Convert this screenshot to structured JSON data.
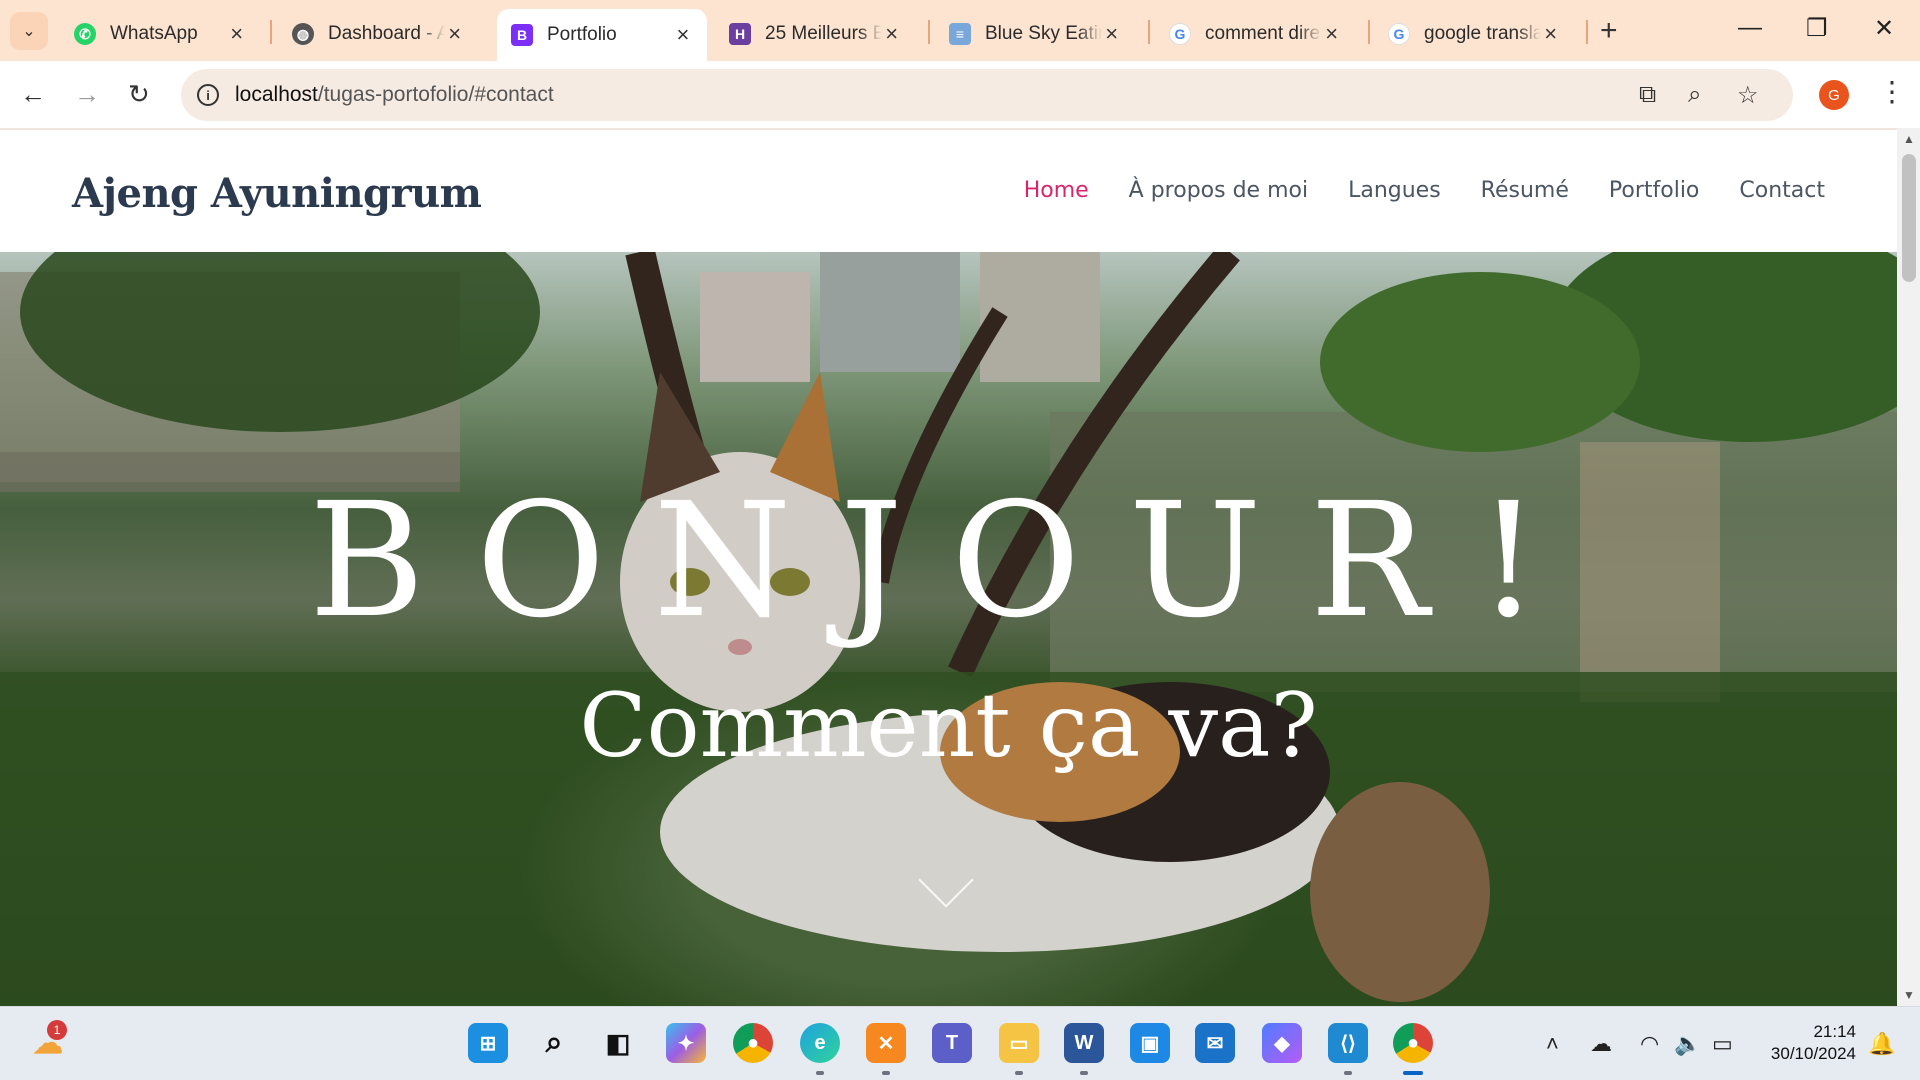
{
  "browser": {
    "tabs": [
      {
        "title": "WhatsApp",
        "favicon_color": "#25d366",
        "favicon": "whatsapp-icon",
        "active": false
      },
      {
        "title": "Dashboard - A",
        "favicon_color": "#555555",
        "favicon": "globe-icon",
        "active": false
      },
      {
        "title": "Portfolio",
        "favicon_color": "#7b2ff7",
        "favicon": "bootstrap-icon",
        "favicon_text": "B",
        "active": true
      },
      {
        "title": "25 Meilleurs E",
        "favicon_color": "#6b3fa0",
        "favicon": "h-icon",
        "active": false
      },
      {
        "title": "Blue Sky Eatin",
        "favicon_color": "#7aa7d9",
        "favicon": "doc-icon",
        "active": false
      },
      {
        "title": "comment dire",
        "favicon_color": "#ffffff",
        "favicon": "google-icon",
        "active": false
      },
      {
        "title": "google transla",
        "favicon_color": "#ffffff",
        "favicon": "google-icon",
        "active": false
      }
    ],
    "url_host": "localhost",
    "url_path": "/tugas-portofolio/#contact",
    "profile_initial": "G"
  },
  "site": {
    "brand": "Ajeng Ayuningrum",
    "nav": [
      {
        "label": "Home",
        "active": true
      },
      {
        "label": "À propos de moi",
        "active": false
      },
      {
        "label": "Langues",
        "active": false
      },
      {
        "label": "Résumé",
        "active": false
      },
      {
        "label": "Portfolio",
        "active": false
      },
      {
        "label": "Contact",
        "active": false
      }
    ],
    "hero_title": "BONJOUR!",
    "hero_subtitle": "Comment ça va?",
    "accent_color": "#d9256b"
  },
  "taskbar": {
    "weather_badge": "1",
    "time": "21:14",
    "date": "30/10/2024"
  }
}
